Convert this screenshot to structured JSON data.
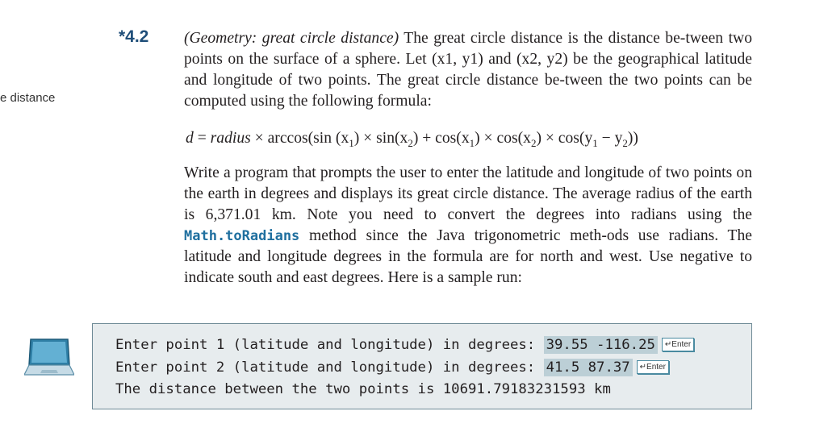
{
  "margin_note": "e distance",
  "exercise": {
    "number": "*4.2",
    "title": "(Geometry: great circle distance)",
    "intro": " The great circle distance is the distance be-tween two points on the surface of a sphere. Let (x1, y1) and (x2, y2) be the geographical latitude and longitude of two points. The great circle distance be-tween the two points can be computed using the following formula:",
    "formula": {
      "d": "d",
      "eq": " = ",
      "radius": "radius",
      "rest_1": " × arccos(sin (x",
      "s1": "1",
      "rest_2": ") × sin(x",
      "s2": "2",
      "rest_3": ") + cos(x",
      "s3": "1",
      "rest_4": ") × cos(x",
      "s4": "2",
      "rest_5": ") × cos(y",
      "s5": "1",
      "rest_6": " − y",
      "s6": "2",
      "rest_7": "))"
    },
    "body_before_code": "Write a program that prompts the user to enter the latitude and longitude of two points on the earth in degrees and displays its great circle distance. The average radius of the earth is 6,371.01 km. Note you need to convert the degrees into radians using the ",
    "code_term": "Math.toRadians",
    "body_after_code": " method since the Java trigonometric meth-ods use radians. The latitude and longitude degrees in the formula are for north and west. Use negative to indicate south and east degrees. Here is a sample run:"
  },
  "sample_run": {
    "line1_prompt": "Enter point 1 (latitude and longitude) in degrees: ",
    "line1_input": "39.55 -116.25",
    "line2_prompt": "Enter point 2 (latitude and longitude) in degrees: ",
    "line2_input": "41.5 87.37",
    "line3_output": "The distance between the two points is 10691.79183231593 km",
    "enter_key_label": "↵Enter"
  },
  "icons": {
    "laptop": "laptop-icon"
  }
}
